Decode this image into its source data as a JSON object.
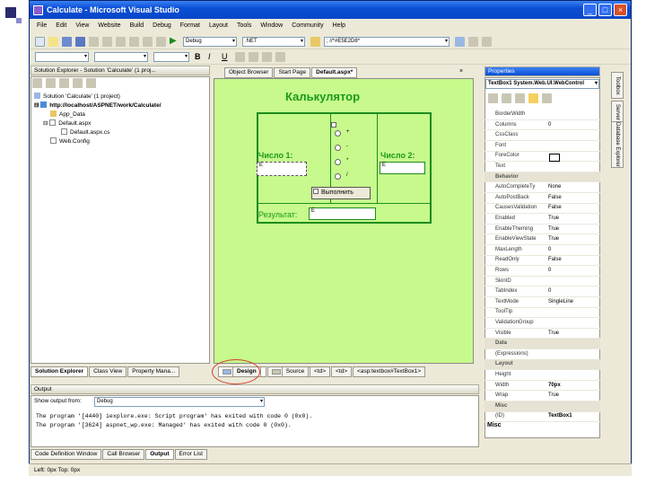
{
  "window": {
    "title": "Calculate - Microsoft Visual Studio"
  },
  "menu": [
    "File",
    "Edit",
    "View",
    "Website",
    "Build",
    "Debug",
    "Format",
    "Layout",
    "Tools",
    "Window",
    "Community",
    "Help"
  ],
  "toolbar": {
    "config": "Debug",
    "platform": ".NET",
    "find": "; //*#E5E2D8*"
  },
  "solution_explorer": {
    "header": "Solution Explorer - Solution 'Calculate' (1 proj...",
    "items": [
      "Solution 'Calculate' (1 project)",
      "http://localhost/ASPNET/work/Calculate/",
      "App_Data",
      "Default.aspx",
      "Default.aspx.cs",
      "Web.Config"
    ],
    "bottom_tabs": [
      "Solution Explorer",
      "Class View",
      "Property Mana..."
    ]
  },
  "doc_tabs": [
    "Object Browser",
    "Start Page",
    "Default.aspx*"
  ],
  "page": {
    "heading": "Калькулятор",
    "label1": "Число 1:",
    "label2": "Число 2:",
    "result_label": "Результат:",
    "button": "Выполнить",
    "ops": [
      "+",
      "-",
      "*",
      "/"
    ],
    "box_prefix": "E"
  },
  "view_tabs": {
    "design": "Design",
    "source": "Source",
    "crumbs": [
      "<td>",
      "<td>",
      "<asp:textbox#TextBox1>"
    ]
  },
  "properties": {
    "header": "Properties",
    "object": "TextBox1 System.Web.UI.WebControl",
    "rows": [
      {
        "n": "BorderWidth",
        "v": "",
        "cat": false
      },
      {
        "n": "Columns",
        "v": "0",
        "cat": false
      },
      {
        "n": "CssClass",
        "v": "",
        "cat": false
      },
      {
        "n": "Font",
        "v": "",
        "cat": false
      },
      {
        "n": "ForeColor",
        "v": "",
        "cat": false
      },
      {
        "n": "Text",
        "v": "",
        "cat": false
      },
      {
        "n": "Behavior",
        "v": "",
        "cat": true
      },
      {
        "n": "AutoCompleteTy",
        "v": "None",
        "cat": false
      },
      {
        "n": "AutoPostBack",
        "v": "False",
        "cat": false
      },
      {
        "n": "CausesValidation",
        "v": "False",
        "cat": false
      },
      {
        "n": "Enabled",
        "v": "True",
        "cat": false
      },
      {
        "n": "EnableTheming",
        "v": "True",
        "cat": false
      },
      {
        "n": "EnableViewState",
        "v": "True",
        "cat": false
      },
      {
        "n": "MaxLength",
        "v": "0",
        "cat": false
      },
      {
        "n": "ReadOnly",
        "v": "False",
        "cat": false
      },
      {
        "n": "Rows",
        "v": "0",
        "cat": false
      },
      {
        "n": "SkinID",
        "v": "",
        "cat": false
      },
      {
        "n": "TabIndex",
        "v": "0",
        "cat": false
      },
      {
        "n": "TextMode",
        "v": "SingleLine",
        "cat": false
      },
      {
        "n": "ToolTip",
        "v": "",
        "cat": false
      },
      {
        "n": "ValidationGroup",
        "v": "",
        "cat": false
      },
      {
        "n": "Visible",
        "v": "True",
        "cat": false
      },
      {
        "n": "Data",
        "v": "",
        "cat": true
      },
      {
        "n": "(Expressions)",
        "v": "",
        "cat": false
      },
      {
        "n": "Layout",
        "v": "",
        "cat": true
      },
      {
        "n": "Height",
        "v": "",
        "cat": false
      },
      {
        "n": "Width",
        "v": "70px",
        "cat": false
      },
      {
        "n": "Wrap",
        "v": "True",
        "cat": false
      },
      {
        "n": "Misc",
        "v": "",
        "cat": true
      },
      {
        "n": "(ID)",
        "v": "TextBox1",
        "cat": false
      }
    ],
    "footer": "Misc"
  },
  "side_tabs": [
    "Toolbox",
    "Server Explorer",
    "Database Explorer"
  ],
  "output": {
    "header": "Output",
    "show_from_label": "Show output from:",
    "show_from": "Debug",
    "lines": [
      "The program '[4440] iexplore.exe: Script program' has exited with code 0 (0x0).",
      "The program '[3624] aspnet_wp.exe: Managed' has exited with code 0 (0x0)."
    ]
  },
  "bottom_tabs": [
    "Code Definition Window",
    "Call Browser",
    "Output",
    "Error List"
  ],
  "status": "Left: 0px Top: 0px",
  "colors": {
    "design_bg": "#c7f98c",
    "accent_green": "#1e8c1e",
    "highlight_red": "#d23a2a"
  }
}
